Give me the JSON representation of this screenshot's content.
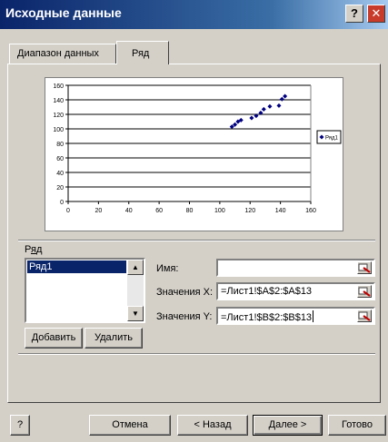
{
  "window": {
    "title": "Исходные данные",
    "help_label": "?",
    "close_label": "✕"
  },
  "tabs": [
    {
      "label": "Диапазон данных",
      "active": false
    },
    {
      "label": "Ряд",
      "active": true
    }
  ],
  "chart_data": {
    "type": "scatter",
    "x_ticks": [
      0,
      20,
      40,
      60,
      80,
      100,
      120,
      140,
      160
    ],
    "y_ticks": [
      0,
      20,
      40,
      60,
      80,
      100,
      120,
      140,
      160
    ],
    "xlim": [
      0,
      160
    ],
    "ylim": [
      0,
      160
    ],
    "grid": true,
    "legend_position": "right",
    "series": [
      {
        "name": "Ряд1",
        "color": "#000080",
        "points": [
          [
            108,
            103
          ],
          [
            110,
            106
          ],
          [
            112,
            110
          ],
          [
            114,
            112
          ],
          [
            121,
            115
          ],
          [
            124,
            118
          ],
          [
            127,
            122
          ],
          [
            129,
            127
          ],
          [
            133,
            131
          ],
          [
            139,
            132
          ],
          [
            141,
            141
          ],
          [
            143,
            145
          ]
        ]
      }
    ]
  },
  "series_section": {
    "label": "Ряд",
    "label_underline": "я",
    "items": [
      "Ряд1"
    ],
    "selected": "Ряд1",
    "scroll_up": "▲",
    "scroll_down": "▼",
    "add_button": "Добавить",
    "remove_button": "Удалить"
  },
  "fields": {
    "name_label": "Имя:",
    "name_value": "",
    "x_label": "Значения X:",
    "x_value": "=Лист1!$A$2:$A$13",
    "y_label": "Значения Y:",
    "y_value": "=Лист1!$B$2:$B$13"
  },
  "footer": {
    "help": "?",
    "cancel": "Отмена",
    "back": "< Назад",
    "next": "Далее >",
    "finish": "Готово"
  }
}
